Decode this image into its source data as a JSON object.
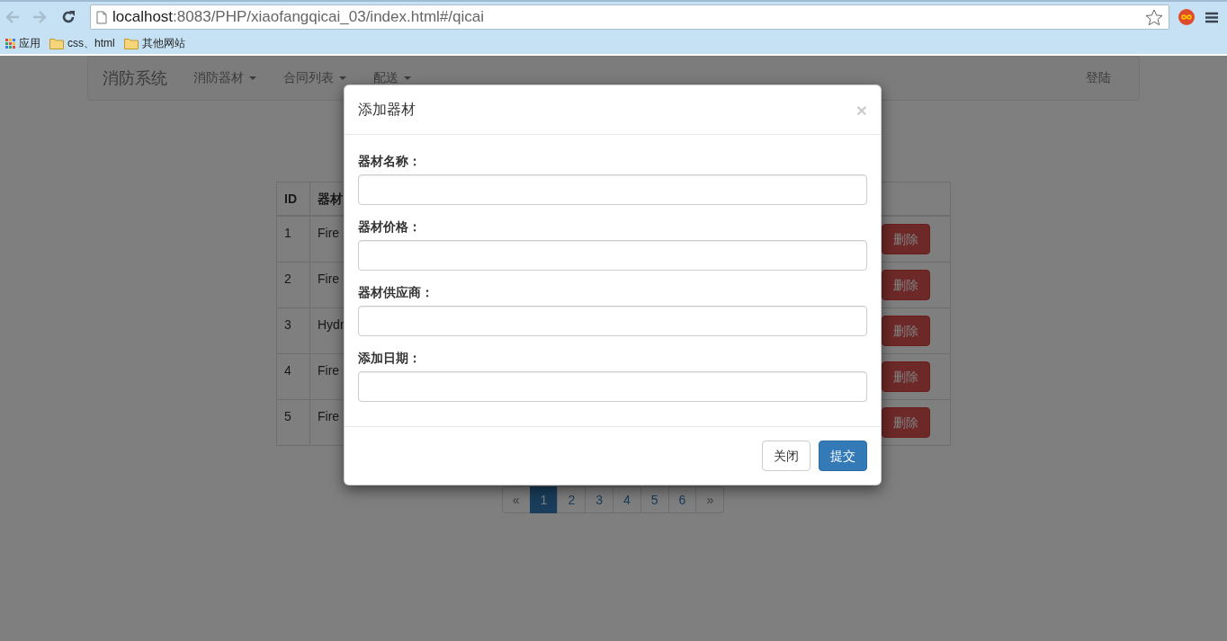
{
  "browser": {
    "url_host": "localhost",
    "url_rest": ":8083/PHP/xiaofangqicai_03/index.html#/qicai",
    "back_enabled": false,
    "forward_enabled": false,
    "bookmarks": [
      {
        "kind": "apps",
        "label": "应用"
      },
      {
        "kind": "folder",
        "label": "css、html"
      },
      {
        "kind": "folder",
        "label": "其他网站"
      }
    ]
  },
  "navbar": {
    "brand": "消防系统",
    "menus": [
      {
        "label": "消防器材",
        "dropdown": true
      },
      {
        "label": "合同列表",
        "dropdown": true
      },
      {
        "label": "配送",
        "dropdown": true
      }
    ],
    "right": "登陆"
  },
  "table": {
    "columns": [
      "ID",
      "器材"
    ],
    "rows": [
      {
        "id": "1",
        "name": "Fire",
        "action": "删除"
      },
      {
        "id": "2",
        "name": "Fire",
        "action": "删除"
      },
      {
        "id": "3",
        "name": "Hydr",
        "action": "删除"
      },
      {
        "id": "4",
        "name": "Fire",
        "action": "删除"
      },
      {
        "id": "5",
        "name": "Fire",
        "action": "删除"
      }
    ]
  },
  "pagination": {
    "prev": "«",
    "next": "»",
    "pages": [
      {
        "label": "1",
        "selected": true
      },
      {
        "label": "2",
        "selected": false
      },
      {
        "label": "3",
        "selected": false
      },
      {
        "label": "4",
        "selected": false
      },
      {
        "label": "5",
        "selected": false
      },
      {
        "label": "6",
        "selected": false
      }
    ]
  },
  "modal": {
    "title": "添加器材",
    "close": "×",
    "fields": [
      {
        "label": "器材名称："
      },
      {
        "label": "器材价格："
      },
      {
        "label": "器材供应商："
      },
      {
        "label": "添加日期："
      }
    ],
    "buttons": [
      {
        "label": "关闭",
        "kind": "default"
      },
      {
        "label": "提交",
        "kind": "primary"
      }
    ]
  }
}
